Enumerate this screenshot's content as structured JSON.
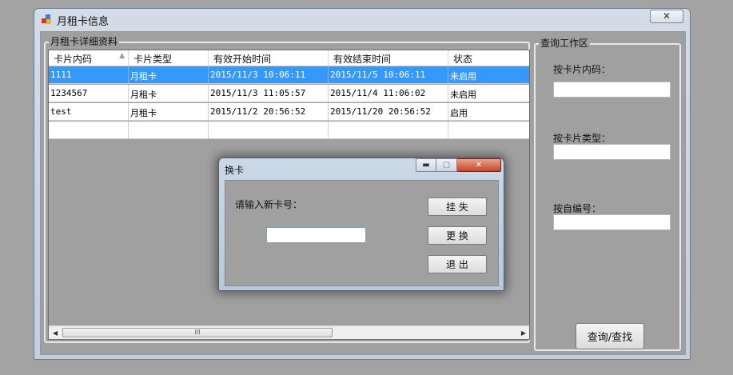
{
  "window": {
    "title": "月租卡信息",
    "close_glyph": "✕"
  },
  "details_group": {
    "legend": "月租卡详细资料",
    "columns": [
      "卡片内码",
      "卡片类型",
      "有效开始时间",
      "有效结束时间",
      "状态"
    ],
    "sort_indicator": "▲",
    "rows": [
      [
        "1111",
        "月租卡",
        "2015/11/3 10:06:11",
        "2015/11/5 10:06:11",
        "未启用"
      ],
      [
        "1234567",
        "月租卡",
        "2015/11/3 11:05:57",
        "2015/11/4 11:06:02",
        "未启用"
      ],
      [
        "test",
        "月租卡",
        "2015/11/2 20:56:52",
        "2015/11/20 20:56:52",
        "启用"
      ]
    ],
    "scroll": {
      "left": "◀",
      "right": "▶",
      "grip": "III"
    }
  },
  "query_group": {
    "legend": "查询工作区",
    "label_card_code": "按卡片内码：",
    "label_card_type": "按卡片类型：",
    "label_number": "按自编号：",
    "input_card_code": "",
    "input_card_type": "",
    "input_number": "",
    "search_button": "查询/查找"
  },
  "dialog": {
    "title": "换卡",
    "min_glyph": "▬",
    "max_glyph": "▢",
    "close_glyph": "✕",
    "prompt": "请输入新卡号：",
    "input_value": "",
    "btn_lost": "挂 失",
    "btn_replace": "更 换",
    "btn_exit": "退 出"
  },
  "colors": {
    "selection": "#3399ff",
    "client_bg": "#a0a0a0",
    "desktop_bg": "#a3a3a3"
  }
}
